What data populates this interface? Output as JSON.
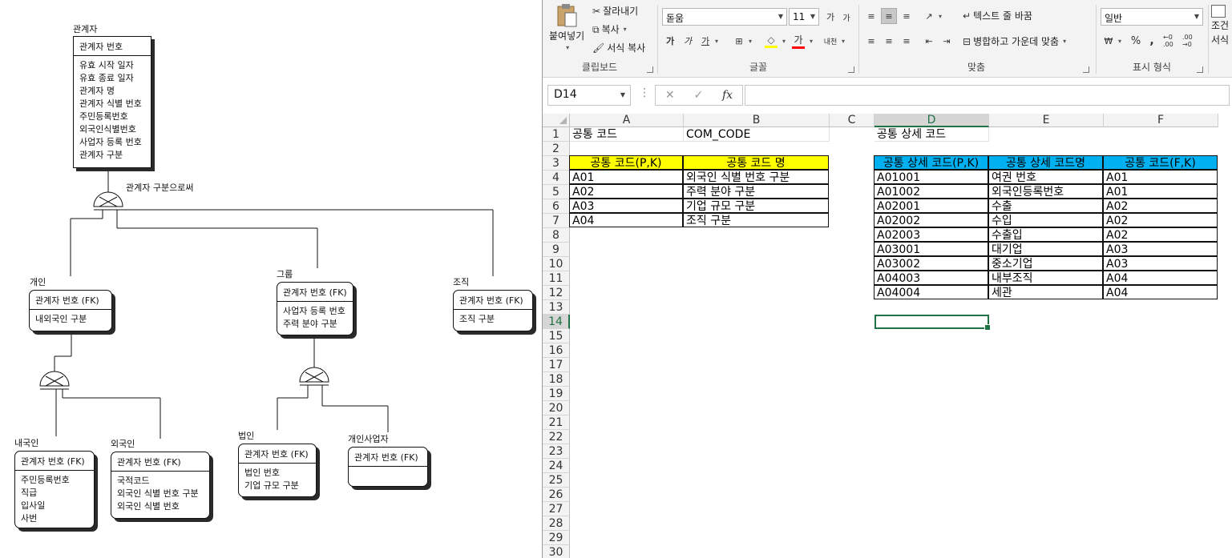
{
  "erd": {
    "root": {
      "title": "관계자",
      "pk": "관계자 번호",
      "attrs": [
        "유효 시작 일자",
        "유효 종료 일자",
        "관계자 명",
        "관계자 식별 번호",
        "주민등록번호",
        "외국인식별번호",
        "사업자 등록 번호",
        "관계자 구분"
      ]
    },
    "discriminator_label": "관계자 구분으로써",
    "individual": {
      "title": "개인",
      "pk": "관계자 번호 (FK)",
      "attrs": [
        "내외국인 구분"
      ]
    },
    "group": {
      "title": "그룹",
      "pk": "관계자 번호 (FK)",
      "attrs": [
        "사업자 등록 번호",
        "주력 분야 구분"
      ]
    },
    "org": {
      "title": "조직",
      "pk": "관계자 번호 (FK)",
      "attrs": [
        "조직 구분"
      ]
    },
    "domestic": {
      "title": "내국인",
      "pk": "관계자 번호 (FK)",
      "attrs": [
        "주민등록번호",
        "직급",
        "입사일",
        "사번"
      ]
    },
    "foreigner": {
      "title": "외국인",
      "pk": "관계자 번호 (FK)",
      "attrs": [
        "국적코드",
        "외국인 식별 번호 구분",
        "외국인 식별 번호"
      ]
    },
    "corp": {
      "title": "법인",
      "pk": "관계자 번호 (FK)",
      "attrs": [
        "법인 번호",
        "기업 규모 구분"
      ]
    },
    "sole": {
      "title": "개인사업자",
      "pk": "관계자 번호 (FK)",
      "attrs": []
    }
  },
  "excel": {
    "ribbon": {
      "clipboard": {
        "paste": "붙여넣기",
        "cut": "잘라내기",
        "copy": "복사",
        "format_painter": "서식 복사",
        "label": "클립보드"
      },
      "font": {
        "name": "돋움",
        "size": "11",
        "grow": "가",
        "shrink": "가",
        "bold": "가",
        "italic": "가",
        "underline": "가",
        "label": "글꼴",
        "font_color_glyph": "가",
        "phonetic": "내천"
      },
      "alignment": {
        "wrap": "텍스트 줄 바꿈",
        "merge": "병합하고 가운데 맞춤",
        "label": "맞춤"
      },
      "number": {
        "format": "일반",
        "percent": "%",
        "comma": ",",
        "inc": "←0 .00",
        "dec": ".00 →0",
        "label": "표시 형식"
      },
      "styles": {
        "cond_fmt_1": "조건",
        "cond_fmt_2": "서식"
      }
    },
    "name_box": "D14",
    "columns": [
      "A",
      "B",
      "C",
      "D",
      "E",
      "F"
    ],
    "rows": [
      "1",
      "2",
      "3",
      "4",
      "5",
      "6",
      "7",
      "8",
      "9",
      "10",
      "11",
      "12",
      "13",
      "14",
      "15",
      "16",
      "17",
      "18",
      "19",
      "20",
      "21",
      "22",
      "23",
      "24",
      "25",
      "26",
      "27",
      "28",
      "29",
      "30"
    ],
    "active_cell": "D14",
    "table1": {
      "title": "공통 코드",
      "title_eng": "COM_CODE",
      "headers": [
        "공통 코드(P,K)",
        "공통 코드 명"
      ],
      "rows": [
        [
          "A01",
          "외국인 식별 번호 구분"
        ],
        [
          "A02",
          "주력 분야 구분"
        ],
        [
          "A03",
          "기업 규모 구분"
        ],
        [
          "A04",
          "조직 구분"
        ]
      ],
      "header_color": "#ffff00"
    },
    "table2": {
      "title": "공통 상세 코드",
      "headers": [
        "공통 상세 코드(P,K)",
        "공통 상세 코드명",
        "공통 코드(F,K)"
      ],
      "rows": [
        [
          "A01001",
          "여권 번호",
          "A01"
        ],
        [
          "A01002",
          "외국인등록번호",
          "A01"
        ],
        [
          "A02001",
          "수출",
          "A02"
        ],
        [
          "A02002",
          "수입",
          "A02"
        ],
        [
          "A02003",
          "수출입",
          "A02"
        ],
        [
          "A03001",
          "대기업",
          "A03"
        ],
        [
          "A03002",
          "중소기업",
          "A03"
        ],
        [
          "A04003",
          "내부조직",
          "A04"
        ],
        [
          "A04004",
          "세관",
          "A04"
        ]
      ],
      "header_color": "#00b0f0"
    },
    "accent_color": "#217346"
  }
}
